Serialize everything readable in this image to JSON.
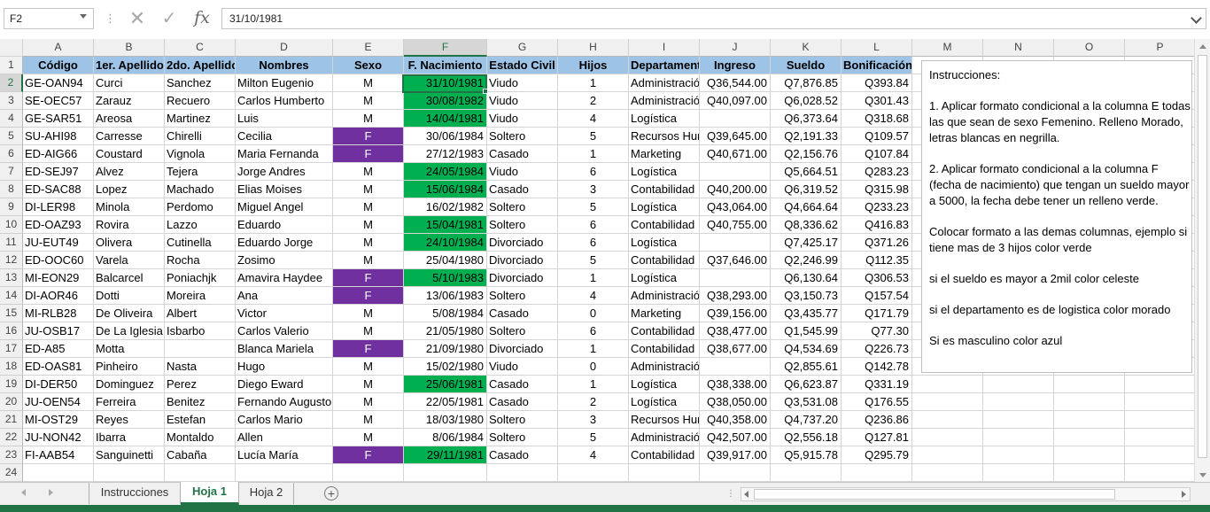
{
  "formula_bar": {
    "name_box": "F2",
    "formula": "31/10/1981"
  },
  "columns": [
    "A",
    "B",
    "C",
    "D",
    "E",
    "F",
    "G",
    "H",
    "I",
    "J",
    "K",
    "L",
    "M",
    "N",
    "O",
    "P"
  ],
  "selected_column": "F",
  "selected_row": 2,
  "header_row": [
    "Código",
    "1er. Apellido",
    "2do. Apellido",
    "Nombres",
    "Sexo",
    "F. Nacimiento",
    "Estado Civil",
    "Hijos",
    "Departamento",
    "Ingreso",
    "Sueldo",
    "Bonificación"
  ],
  "rows": [
    [
      "GE-OAN94",
      "Curci",
      "Sanchez",
      "Milton Eugenio",
      "M",
      "31/10/1981",
      "Viudo",
      "1",
      "Administración",
      "Q36,544.00",
      "Q7,876.85",
      "Q393.84"
    ],
    [
      "SE-OEC57",
      "Zarauz",
      "Recuero",
      "Carlos Humberto",
      "M",
      "30/08/1982",
      "Viudo",
      "2",
      "Administración",
      "Q40,097.00",
      "Q6,028.52",
      "Q301.43"
    ],
    [
      "GE-SAR51",
      "Areosa",
      "Martinez",
      "Luis",
      "M",
      "14/04/1981",
      "Viudo",
      "4",
      "Logística",
      "",
      "Q6,373.64",
      "Q318.68"
    ],
    [
      "SU-AHI98",
      "Carresse",
      "Chirelli",
      "Cecilia",
      "F",
      "30/06/1984",
      "Soltero",
      "5",
      "Recursos Humanos",
      "Q39,645.00",
      "Q2,191.33",
      "Q109.57"
    ],
    [
      "ED-AIG66",
      "Coustard",
      "Vignola",
      "Maria Fernanda",
      "F",
      "27/12/1983",
      "Casado",
      "1",
      "Marketing",
      "Q40,671.00",
      "Q2,156.76",
      "Q107.84"
    ],
    [
      "ED-SEJ97",
      "Alvez",
      "Tejera",
      "Jorge Andres",
      "M",
      "24/05/1984",
      "Viudo",
      "6",
      "Logística",
      "",
      "Q5,664.51",
      "Q283.23"
    ],
    [
      "ED-SAC88",
      "Lopez",
      "Machado",
      "Elias Moises",
      "M",
      "15/06/1984",
      "Casado",
      "3",
      "Contabilidad",
      "Q40,200.00",
      "Q6,319.52",
      "Q315.98"
    ],
    [
      "DI-LER98",
      "Minola",
      "Perdomo",
      "Miguel Angel",
      "M",
      "16/02/1982",
      "Soltero",
      "5",
      "Logística",
      "Q43,064.00",
      "Q4,664.64",
      "Q233.23"
    ],
    [
      "ED-OAZ93",
      "Rovira",
      "Lazzo",
      "Eduardo",
      "M",
      "15/04/1981",
      "Soltero",
      "6",
      "Contabilidad",
      "Q40,755.00",
      "Q8,336.62",
      "Q416.83"
    ],
    [
      "JU-EUT49",
      "Olivera",
      "Cutinella",
      "Eduardo Jorge",
      "M",
      "24/10/1984",
      "Divorciado",
      "6",
      "Logística",
      "",
      "Q7,425.17",
      "Q371.26"
    ],
    [
      "ED-OOC60",
      "Varela",
      "Rocha",
      "Zosimo",
      "M",
      "25/04/1980",
      "Divorciado",
      "5",
      "Contabilidad",
      "Q37,646.00",
      "Q2,246.99",
      "Q112.35"
    ],
    [
      "MI-EON29",
      "Balcarcel",
      "Poniachjk",
      "Amavira Haydee",
      "F",
      "5/10/1983",
      "Divorciado",
      "1",
      "Logística",
      "",
      "Q6,130.64",
      "Q306.53"
    ],
    [
      "DI-AOR46",
      "Dotti",
      "Moreira",
      "Ana",
      "F",
      "13/06/1983",
      "Soltero",
      "4",
      "Administración",
      "Q38,293.00",
      "Q3,150.73",
      "Q157.54"
    ],
    [
      "MI-RLB28",
      "De Oliveira",
      "Albert",
      "Victor",
      "M",
      "5/08/1984",
      "Casado",
      "0",
      "Marketing",
      "Q39,156.00",
      "Q3,435.77",
      "Q171.79"
    ],
    [
      "JU-OSB17",
      "De La Iglesia",
      "Isbarbo",
      "Carlos Valerio",
      "M",
      "21/05/1980",
      "Soltero",
      "6",
      "Contabilidad",
      "Q38,477.00",
      "Q1,545.99",
      "Q77.30"
    ],
    [
      "ED-A85",
      "Motta",
      "",
      "Blanca Mariela",
      "F",
      "21/09/1980",
      "Divorciado",
      "1",
      "Contabilidad",
      "Q38,677.00",
      "Q4,534.69",
      "Q226.73"
    ],
    [
      "ED-OAS81",
      "Pinheiro",
      "Nasta",
      "Hugo",
      "M",
      "15/02/1980",
      "Viudo",
      "0",
      "Administración",
      "",
      "Q2,855.61",
      "Q142.78"
    ],
    [
      "DI-DER50",
      "Dominguez",
      "Perez",
      "Diego Eward",
      "M",
      "25/06/1981",
      "Casado",
      "1",
      "Logística",
      "Q38,338.00",
      "Q6,623.87",
      "Q331.19"
    ],
    [
      "JU-OEN54",
      "Ferreira",
      "Benitez",
      "Fernando Augusto",
      "M",
      "22/05/1981",
      "Casado",
      "2",
      "Logística",
      "Q38,050.00",
      "Q3,531.08",
      "Q176.55"
    ],
    [
      "MI-OST29",
      "Reyes",
      "Estefan",
      "Carlos Mario",
      "M",
      "18/03/1980",
      "Soltero",
      "3",
      "Recursos Humanos",
      "Q40,358.00",
      "Q4,737.20",
      "Q236.86"
    ],
    [
      "JU-NON42",
      "Ibarra",
      "Montaldo",
      "Allen",
      "M",
      "8/06/1984",
      "Soltero",
      "5",
      "Administración",
      "Q42,507.00",
      "Q2,556.18",
      "Q127.81"
    ],
    [
      "FI-AAB54",
      "Sanguinetti",
      "Cabaña",
      "Lucía María",
      "F",
      "29/11/1981",
      "Casado",
      "4",
      "Contabilidad",
      "Q39,917.00",
      "Q5,915.78",
      "Q295.79"
    ]
  ],
  "instructions": [
    "Instrucciones:",
    "",
    "1. Aplicar formato condicional a la columna E todas",
    "las que sean de sexo Femenino. Relleno Morado,",
    "letras blancas en negrilla.",
    "",
    "2. Aplicar formato condicional  a la columna F",
    "(fecha de nacimiento) que tengan un sueldo mayor",
    "a 5000, la fecha debe tener un relleno verde.",
    "",
    "Colocar formato a las demas columnas, ejemplo si",
    "tiene mas de 3 hijos color verde",
    "",
    "si el sueldo es mayor a 2mil color celeste",
    "",
    "si el departamento es de logistica color morado",
    "",
    "Si es masculino color azul"
  ],
  "sheet_tabs": [
    {
      "label": "Instrucciones",
      "active": false
    },
    {
      "label": "Hoja 1",
      "active": true
    },
    {
      "label": "Hoja 2",
      "active": false
    }
  ],
  "colors": {
    "female_fill": "#7030a0",
    "date_fill": "#00b050",
    "header_fill": "#9dc3e6",
    "accent": "#217346"
  }
}
